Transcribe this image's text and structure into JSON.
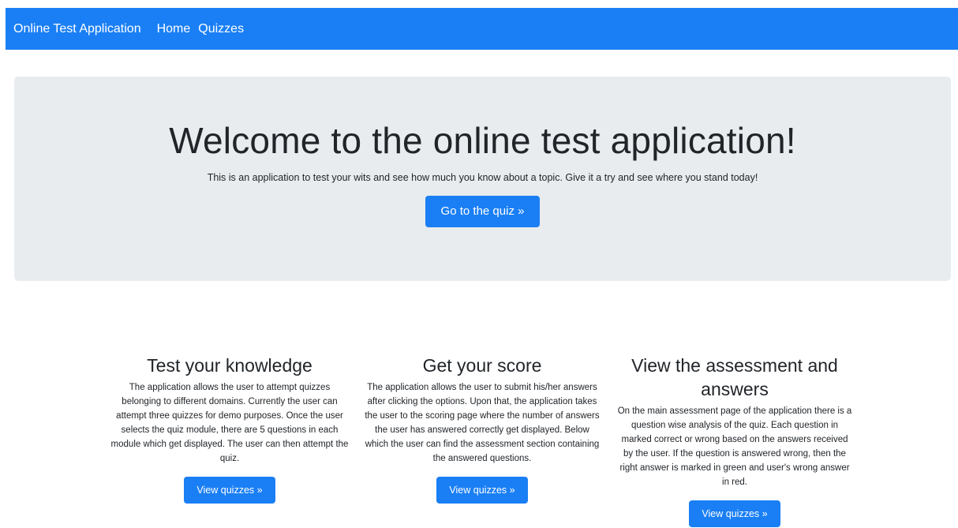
{
  "navbar": {
    "brand": "Online Test Application",
    "links": [
      "Home",
      "Quizzes"
    ]
  },
  "jumbotron": {
    "title": "Welcome to the online test application!",
    "lead": "This is an application to test your wits and see how much you know about a topic. Give it a try and see where you stand today!",
    "button_label": "Go to the quiz »"
  },
  "features": [
    {
      "title": "Test your knowledge",
      "text": "The application allows the user to attempt quizzes belonging to different domains. Currently the user can attempt three quizzes for demo purposes. Once the user selects the quiz module, there are 5 questions in each module which get displayed. The user can then attempt the quiz.",
      "button_label": "View quizzes »"
    },
    {
      "title": "Get your score",
      "text": "The application allows the user to submit his/her answers after clicking the options. Upon that, the application takes the user to the scoring page where the number of answers the user has answered correctly get displayed. Below which the user can find the assessment section containing the answered questions.",
      "button_label": "View quizzes »"
    },
    {
      "title": "View the assessment and answers",
      "text": "On the main assessment page of the application there is a question wise analysis of the quiz. Each question in marked correct or wrong based on the answers received by the user. If the question is answered wrong, then the right answer is marked in green and user's wrong answer in red.",
      "button_label": "View quizzes »"
    }
  ],
  "colors": {
    "primary": "#1a7ff5",
    "jumbotron_bg": "#e9ecef",
    "text": "#212529"
  }
}
